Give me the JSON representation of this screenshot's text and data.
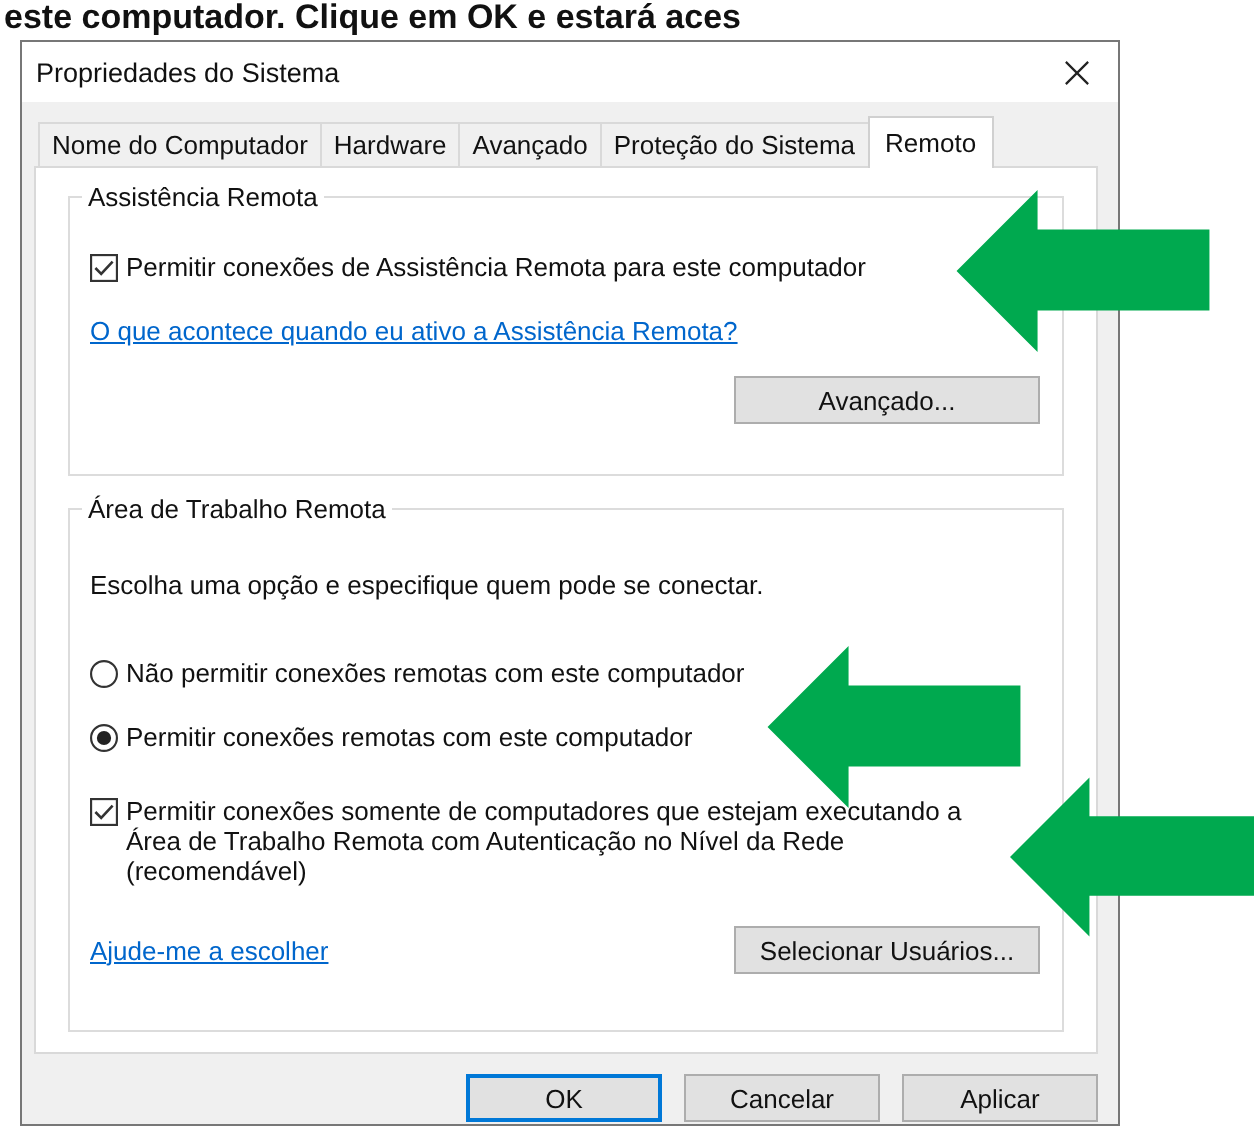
{
  "caption_fragment": "este computador. Clique em OK e estará aces",
  "window": {
    "title": "Propriedades do Sistema"
  },
  "tabs": [
    {
      "label": "Nome do Computador",
      "selected": false
    },
    {
      "label": "Hardware",
      "selected": false
    },
    {
      "label": "Avançado",
      "selected": false
    },
    {
      "label": "Proteção do Sistema",
      "selected": false
    },
    {
      "label": "Remoto",
      "selected": true
    }
  ],
  "remote_assistance": {
    "title": "Assistência Remota",
    "checkbox": {
      "label": "Permitir conexões de Assistência Remota para este computador",
      "checked": true
    },
    "link": "O que acontece quando eu ativo a Assistência Remota?",
    "button": "Avançado..."
  },
  "remote_desktop": {
    "title": "Área de Trabalho Remota",
    "instruction": "Escolha uma opção e especifique quem pode se conectar.",
    "options": [
      {
        "label": "Não permitir conexões remotas com este computador",
        "selected": false
      },
      {
        "label": "Permitir conexões remotas com este computador",
        "selected": true
      }
    ],
    "checkbox": {
      "label": "Permitir conexões somente de computadores que estejam executando a Área de Trabalho Remota com Autenticação no Nível da Rede (recomendável)",
      "checked": true
    },
    "link": "Ajude-me a escolher",
    "button": "Selecionar Usuários..."
  },
  "buttons": [
    {
      "label": "OK",
      "default": true
    },
    {
      "label": "Cancelar",
      "default": false
    },
    {
      "label": "Aplicar",
      "default": false
    }
  ]
}
